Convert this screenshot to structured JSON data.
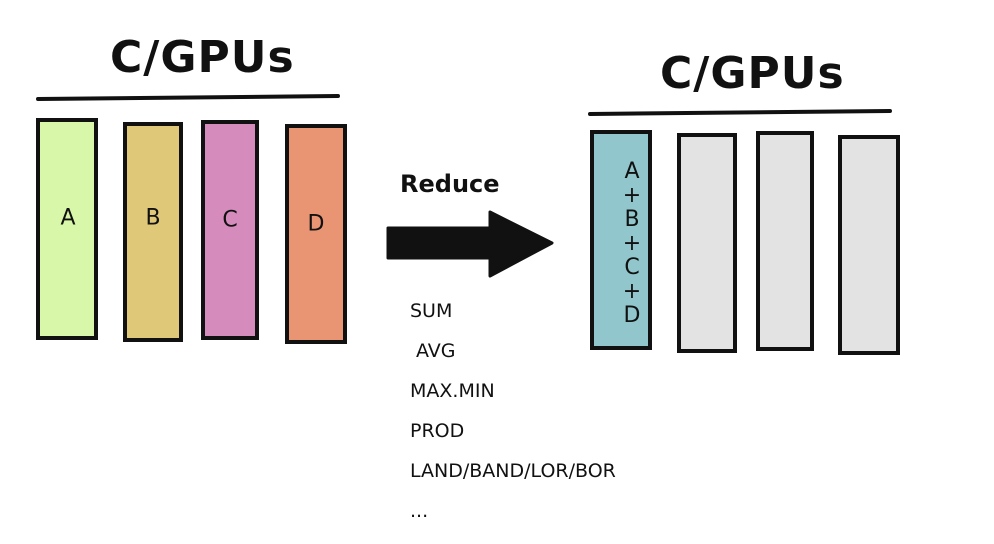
{
  "left_group": {
    "title": "C/GPUs",
    "bars": [
      {
        "label": "A",
        "color": "#d8f7a8"
      },
      {
        "label": "B",
        "color": "#dfc878"
      },
      {
        "label": "C",
        "color": "#d58cbd"
      },
      {
        "label": "D",
        "color": "#e99574"
      }
    ]
  },
  "arrow": {
    "label": "Reduce"
  },
  "right_group": {
    "title": "C/GPUs",
    "result_label": "A+B+C+D",
    "result_color": "#90c6cc",
    "empty_color": "#e3e3e3"
  },
  "operations": [
    "SUM",
    "AVG",
    "MAX.MIN",
    "PROD",
    "LAND/BAND/LOR/BOR",
    "..."
  ]
}
